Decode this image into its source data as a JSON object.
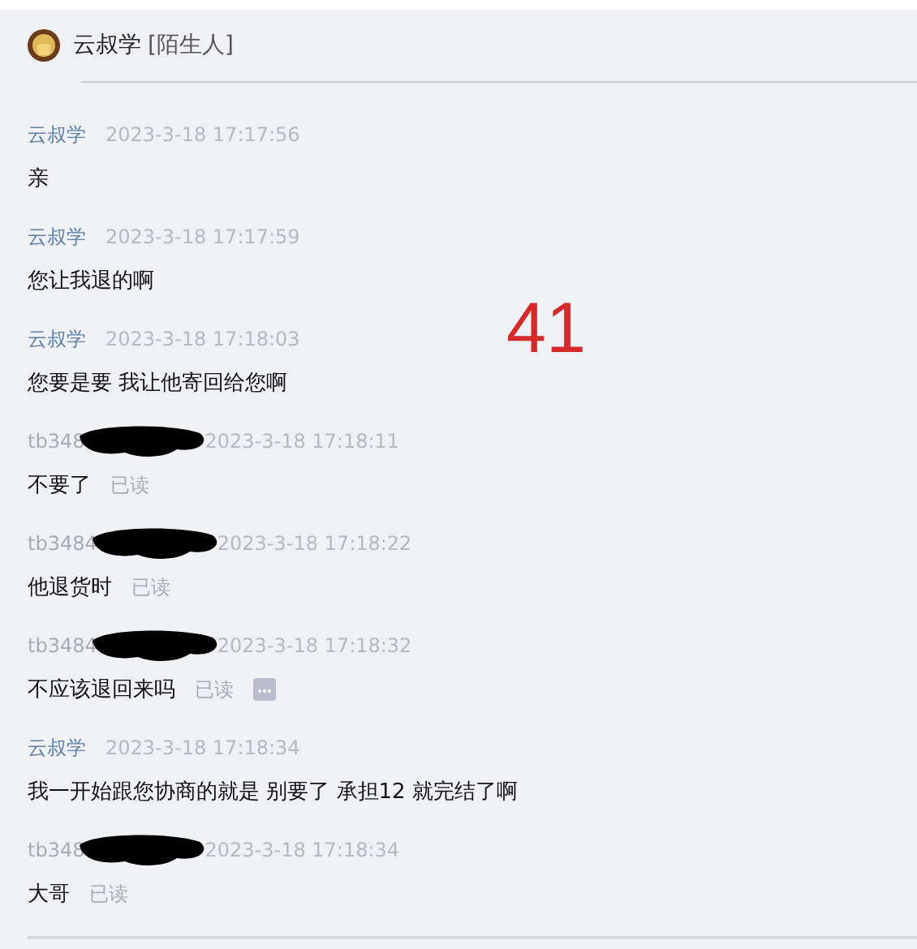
{
  "header": {
    "name": "云叔学",
    "tag": "[陌生人]"
  },
  "messages": [
    {
      "sender": "云叔学",
      "kind": "agent",
      "time": "2023-3-18 17:17:56",
      "text": "亲"
    },
    {
      "sender": "云叔学",
      "kind": "agent",
      "time": "2023-3-18 17:17:59",
      "text": "您让我退的啊"
    },
    {
      "sender": "云叔学",
      "kind": "agent",
      "time": "2023-3-18 17:18:03",
      "text": "您要是要 我让他寄回给您啊"
    },
    {
      "sender": "tb348",
      "kind": "customer",
      "redacted": true,
      "time": "2023-3-18 17:18:11",
      "text": "不要了",
      "status": "已读"
    },
    {
      "sender": "tb3484",
      "kind": "customer",
      "redacted": true,
      "time": "2023-3-18 17:18:22",
      "text": "他退货时",
      "status": "已读"
    },
    {
      "sender": "tb3484",
      "kind": "customer",
      "redacted": true,
      "time": "2023-3-18 17:18:32",
      "text": "不应该退回来吗",
      "status": "已读",
      "more": true
    },
    {
      "sender": "云叔学",
      "kind": "agent",
      "time": "2023-3-18 17:18:34",
      "text": "我一开始跟您协商的就是  别要了 承担12 就完结了啊"
    },
    {
      "sender": "tb348",
      "kind": "customer",
      "redacted": true,
      "time": "2023-3-18 17:18:34",
      "text": "大哥",
      "status": "已读"
    }
  ],
  "overlay_number": "41"
}
